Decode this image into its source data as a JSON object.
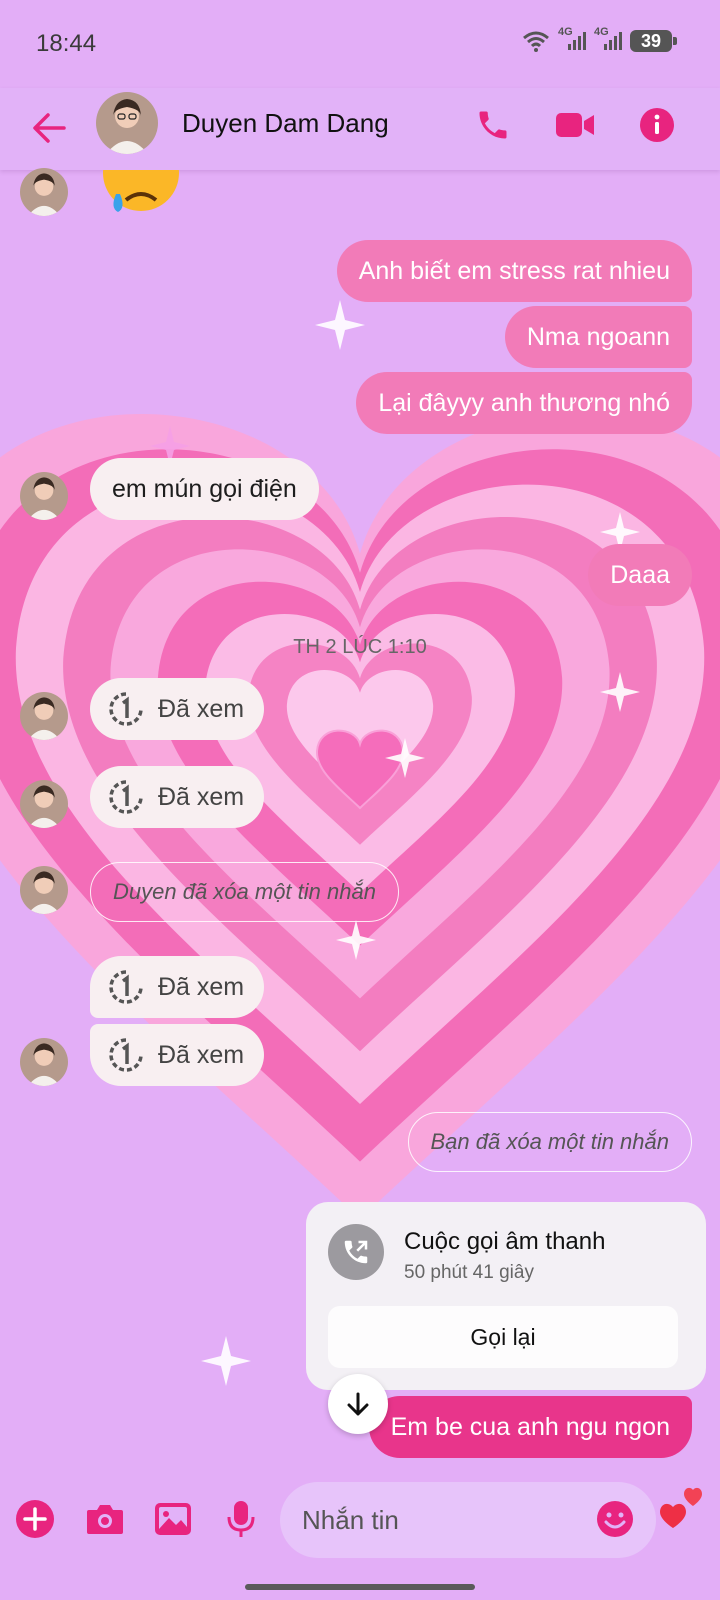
{
  "status_bar": {
    "time": "18:44",
    "network1": "4G",
    "network2": "4G",
    "battery": "39"
  },
  "header": {
    "contact_name": "Duyen Dam Dang"
  },
  "colors": {
    "accent": "#e8247f",
    "outgoing_bubble": "#f27bb8",
    "incoming_bubble": "#f8eff1",
    "background": "#e3aef7"
  },
  "messages": {
    "top_emoji": "😢",
    "out1": "Anh biết em stress rat nhieu",
    "out2": "Nma ngoann",
    "out3": "Lại đâyyy anh thương nhó",
    "in1": "em mún gọi điện",
    "out4": "Daaa",
    "timestamp": "TH 2 LÚC 1:10",
    "seen_label": "Đã xem",
    "deleted_in": "Duyen đã xóa một tin nhắn",
    "deleted_out": "Bạn đã xóa một tin nhắn",
    "last_out": "Em be cua anh ngu ngon"
  },
  "call_card": {
    "title": "Cuộc gọi âm thanh",
    "duration": "50 phút 41 giây",
    "button": "Gọi lại"
  },
  "composer": {
    "placeholder": "Nhắn tin"
  }
}
